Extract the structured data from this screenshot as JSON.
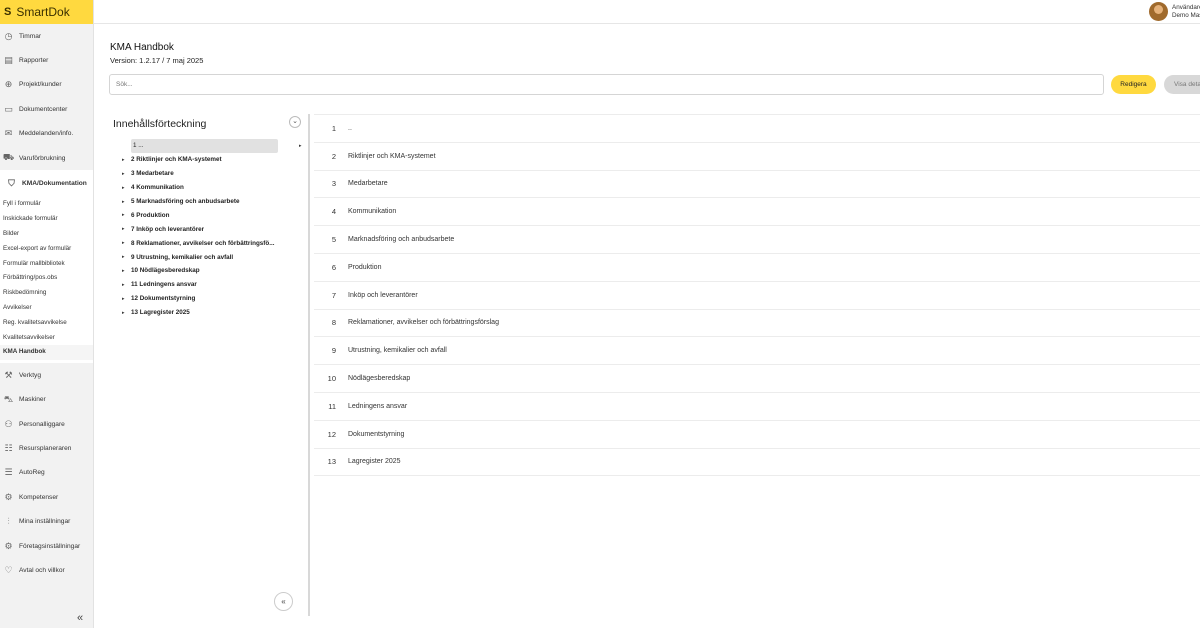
{
  "app": {
    "logo": "SmartDok",
    "logo_mark": "S"
  },
  "user": {
    "line1": "Användare",
    "line2": "Demo Maskin"
  },
  "nav": [
    {
      "label": "Timmar",
      "icon": "clock-icon",
      "glyph": "◷"
    },
    {
      "label": "Rapporter",
      "icon": "report-icon",
      "glyph": "▤"
    },
    {
      "label": "Projekt/kunder",
      "icon": "project-icon",
      "glyph": "⊕"
    },
    {
      "label": "Dokumentcenter",
      "icon": "document-icon",
      "glyph": "▭"
    },
    {
      "label": "Meddelanden/info.",
      "icon": "message-icon",
      "glyph": "✉"
    },
    {
      "label": "Varuförbrukning",
      "icon": "goods-icon",
      "glyph": "⛟"
    }
  ],
  "active_nav": {
    "label": "KMA/Dokumentation",
    "icon": "shield-icon",
    "glyph": "⛉"
  },
  "subnav": [
    "Fyll i formulär",
    "Inskickade formulär",
    "Bilder",
    "Excel-export av formulär",
    "Formulär mallbibliotek",
    "Förbättring/pos.obs",
    "Riskbedömning",
    "Avvikelser",
    "Reg. kvalitetsavvikelse",
    "Kvalitetsavvikelser",
    "KMA Handbok"
  ],
  "nav_bottom": [
    {
      "label": "Verktyg",
      "icon": "tools-icon",
      "glyph": "⚒"
    },
    {
      "label": "Maskiner",
      "icon": "machine-icon",
      "glyph": "⛍"
    },
    {
      "label": "Personalliggare",
      "icon": "people-icon",
      "glyph": "⚇"
    },
    {
      "label": "Resursplaneraren",
      "icon": "planner-icon",
      "glyph": "☷"
    },
    {
      "label": "AutoReg",
      "icon": "autoreg-icon",
      "glyph": "☰"
    },
    {
      "label": "Kompetenser",
      "icon": "competence-icon",
      "glyph": "⚙"
    },
    {
      "label": "Mina inställningar",
      "icon": "sliders-icon",
      "glyph": "⫶"
    },
    {
      "label": "Företagsinställningar",
      "icon": "gear-icon",
      "glyph": "⚙"
    },
    {
      "label": "Avtal och villkor",
      "icon": "handshake-icon",
      "glyph": "♡"
    }
  ],
  "nav_collapse": "«",
  "page": {
    "title": "KMA Handbok",
    "version": "Version: 1.2.17 / 7 maj 2025",
    "search_placeholder": "Sök...",
    "edit_label": "Redigera",
    "details_label": "Visa detaljer"
  },
  "toc": {
    "title": "Innehållsförteckning",
    "toggle": "⌄",
    "collapse": "«",
    "items": [
      "1 ...",
      "2 Riktlinjer och KMA-systemet",
      "3 Medarbetare",
      "4 Kommunikation",
      "5 Marknadsföring och anbudsarbete",
      "6 Produktion",
      "7 Inköp och leverantörer",
      "8 Reklamationer, avvikelser och förbättringsfö...",
      "9 Utrustning, kemikalier och avfall",
      "10 Nödlägesberedskap",
      "11 Ledningens ansvar",
      "12 Dokumentstyrning",
      "13 Lagregister 2025"
    ]
  },
  "chapters": [
    {
      "num": "1",
      "title": ".."
    },
    {
      "num": "2",
      "title": "Riktlinjer och KMA-systemet"
    },
    {
      "num": "3",
      "title": "Medarbetare"
    },
    {
      "num": "4",
      "title": "Kommunikation"
    },
    {
      "num": "5",
      "title": "Marknadsföring och anbudsarbete"
    },
    {
      "num": "6",
      "title": "Produktion"
    },
    {
      "num": "7",
      "title": "Inköp och leverantörer"
    },
    {
      "num": "8",
      "title": "Reklamationer, avvikelser och förbättringsförslag"
    },
    {
      "num": "9",
      "title": "Utrustning, kemikalier och avfall"
    },
    {
      "num": "10",
      "title": "Nödlägesberedskap"
    },
    {
      "num": "11",
      "title": "Ledningens ansvar"
    },
    {
      "num": "12",
      "title": "Dokumentstyrning"
    },
    {
      "num": "13",
      "title": "Lagregister 2025"
    }
  ],
  "colors": {
    "accent": "#ffd93f",
    "sidebar": "#f2f2f2",
    "details_button": "#d8d8d8"
  }
}
